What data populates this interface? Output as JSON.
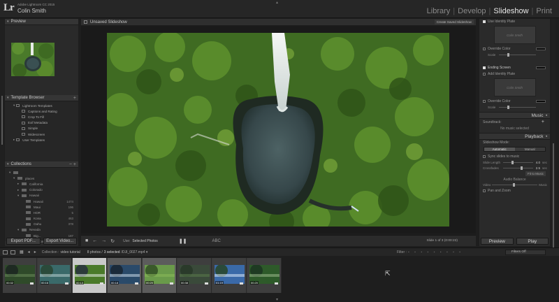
{
  "identity": {
    "logo": "Lr",
    "product": "Adobe Lightroom CC 2015",
    "user": "Colin Smith"
  },
  "modules": {
    "library": "Library",
    "develop": "Develop",
    "slideshow": "Slideshow",
    "print": "Print",
    "separator": "|"
  },
  "left_panel": {
    "preview_title": "Preview",
    "template_browser_title": "Template Browser",
    "templates": [
      {
        "label": "Lightroom Templates",
        "child": false,
        "twisty": "▾"
      },
      {
        "label": "Captions and Rating",
        "child": true,
        "twisty": ""
      },
      {
        "label": "Crop To Fill",
        "child": true,
        "twisty": ""
      },
      {
        "label": "Exif Metadata",
        "child": true,
        "twisty": ""
      },
      {
        "label": "Simple",
        "child": true,
        "twisty": ""
      },
      {
        "label": "Widescreen",
        "child": true,
        "twisty": ""
      },
      {
        "label": "User Templates",
        "child": false,
        "twisty": "▸"
      }
    ],
    "collections_title": "Collections",
    "collections_controls": "− +",
    "collections": [
      {
        "label": "",
        "count": "",
        "indent": 0,
        "twisty": "▾"
      },
      {
        "label": "places",
        "count": "",
        "indent": 1,
        "twisty": "▾"
      },
      {
        "label": "California",
        "count": "",
        "indent": 2,
        "twisty": "▸"
      },
      {
        "label": "Colorado",
        "count": "",
        "indent": 2,
        "twisty": "▸"
      },
      {
        "label": "Hawaii",
        "count": "",
        "indent": 2,
        "twisty": "▾"
      },
      {
        "label": "Hawaii",
        "count": "1474",
        "indent": 3,
        "twisty": ""
      },
      {
        "label": "Maui",
        "count": "196",
        "indent": 3,
        "twisty": ""
      },
      {
        "label": "HDR",
        "count": "5",
        "indent": 3,
        "twisty": ""
      },
      {
        "label": "Kona",
        "count": "463",
        "indent": 3,
        "twisty": ""
      },
      {
        "label": "Oahu",
        "count": "378",
        "indent": 3,
        "twisty": ""
      },
      {
        "label": "Nevada",
        "count": "",
        "indent": 2,
        "twisty": "▾"
      },
      {
        "label": "Big...",
        "count": "187",
        "indent": 3,
        "twisty": ""
      },
      {
        "label": "Nelson",
        "count": "131",
        "indent": 3,
        "twisty": ""
      }
    ],
    "export_pdf": "Export PDF...",
    "export_video": "Export Video..."
  },
  "center": {
    "slideshow_title": "Unsaved Slideshow",
    "create_saved": "Create Saved Slideshow",
    "use_label": "Use:",
    "use_value": "Selected Photos",
    "play_state": "❚❚",
    "abc": "ABC",
    "slide_counter": "Slide 1 of 3 (0:00:22)"
  },
  "right_panel": {
    "use_identity_plate": "Use Identity Plate",
    "identity_plate_text": "Colin Smith",
    "override_color": "Override Color",
    "scale_label": "Scale",
    "ending_screen": "Ending Screen",
    "add_identity_plate": "Add Identity Plate",
    "override_color_2": "Override Color",
    "scale_label_2": "Scale",
    "music_title": "Music",
    "soundtrack": "Soundtrack:",
    "no_music": "No music selected",
    "playback_title": "Playback",
    "slideshow_mode": "Slideshow Mode:",
    "mode_automatic": "Automatic",
    "mode_manual": "Manual",
    "sync_slides": "Sync slides to music",
    "slide_length_label": "Slide Length",
    "slide_length_value": "4.0",
    "slide_length_unit": "sec",
    "slide_length_level": 0.3,
    "crossfades_label": "Crossfades",
    "crossfades_value": "2.5",
    "crossfades_unit": "sec",
    "crossfades_level": 0.6,
    "fit_to_music": "Fit to Music",
    "audio_balance": "Audio Balance",
    "video_label": "Video",
    "music_label": "Music",
    "pan_and_zoom": "Pan and Zoom",
    "preview_button": "Preview",
    "play_button": "Play",
    "collapse_triangle": "◂"
  },
  "filmstrip_bar": {
    "source_label": "Collection :",
    "source": "video tutorial",
    "count": "8 photos /",
    "selected": "3 selected",
    "file": "/DJI_0027.mp4 ▾",
    "filter_label": "Filter :",
    "filter_icons": "▪ ▪ ▪ ▪ ▪ ▪ ▪ ▪ ▪",
    "filter_value": "Filters Off"
  },
  "filmstrip": {
    "thumbs": [
      {
        "duration": "00:32",
        "selected": false,
        "sel_level": 0
      },
      {
        "duration": "00:16",
        "selected": false,
        "sel_level": 0
      },
      {
        "duration": "00:13",
        "selected": true,
        "sel_level": 2
      },
      {
        "duration": "00:18",
        "selected": true,
        "sel_level": 1
      },
      {
        "duration": "00:20",
        "selected": true,
        "sel_level": 1
      },
      {
        "duration": "00:38",
        "selected": false,
        "sel_level": 0
      },
      {
        "duration": "01:19",
        "selected": false,
        "sel_level": 0
      },
      {
        "duration": "00:20",
        "selected": false,
        "sel_level": 0
      }
    ]
  },
  "colors": {
    "background": "#1e1e1e",
    "panel": "#2a2a2a",
    "text": "#b8b8b8",
    "active_module": "#e8e8e8",
    "foliage": "#3f6b22",
    "water": "#3c4a4c"
  }
}
